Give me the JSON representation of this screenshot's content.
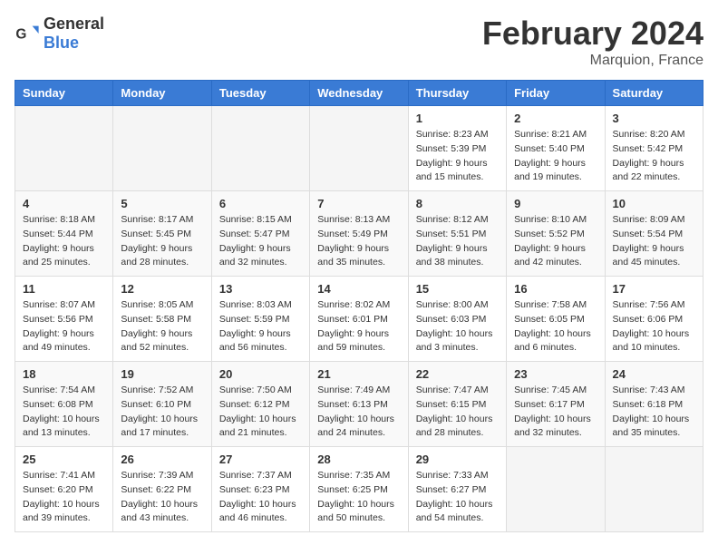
{
  "header": {
    "logo_general": "General",
    "logo_blue": "Blue",
    "main_title": "February 2024",
    "subtitle": "Marquion, France"
  },
  "calendar": {
    "days_of_week": [
      "Sunday",
      "Monday",
      "Tuesday",
      "Wednesday",
      "Thursday",
      "Friday",
      "Saturday"
    ],
    "weeks": [
      {
        "cells": [
          {
            "date": "",
            "info": ""
          },
          {
            "date": "",
            "info": ""
          },
          {
            "date": "",
            "info": ""
          },
          {
            "date": "",
            "info": ""
          },
          {
            "date": "1",
            "info": "Sunrise: 8:23 AM\nSunset: 5:39 PM\nDaylight: 9 hours\nand 15 minutes."
          },
          {
            "date": "2",
            "info": "Sunrise: 8:21 AM\nSunset: 5:40 PM\nDaylight: 9 hours\nand 19 minutes."
          },
          {
            "date": "3",
            "info": "Sunrise: 8:20 AM\nSunset: 5:42 PM\nDaylight: 9 hours\nand 22 minutes."
          }
        ]
      },
      {
        "cells": [
          {
            "date": "4",
            "info": "Sunrise: 8:18 AM\nSunset: 5:44 PM\nDaylight: 9 hours\nand 25 minutes."
          },
          {
            "date": "5",
            "info": "Sunrise: 8:17 AM\nSunset: 5:45 PM\nDaylight: 9 hours\nand 28 minutes."
          },
          {
            "date": "6",
            "info": "Sunrise: 8:15 AM\nSunset: 5:47 PM\nDaylight: 9 hours\nand 32 minutes."
          },
          {
            "date": "7",
            "info": "Sunrise: 8:13 AM\nSunset: 5:49 PM\nDaylight: 9 hours\nand 35 minutes."
          },
          {
            "date": "8",
            "info": "Sunrise: 8:12 AM\nSunset: 5:51 PM\nDaylight: 9 hours\nand 38 minutes."
          },
          {
            "date": "9",
            "info": "Sunrise: 8:10 AM\nSunset: 5:52 PM\nDaylight: 9 hours\nand 42 minutes."
          },
          {
            "date": "10",
            "info": "Sunrise: 8:09 AM\nSunset: 5:54 PM\nDaylight: 9 hours\nand 45 minutes."
          }
        ]
      },
      {
        "cells": [
          {
            "date": "11",
            "info": "Sunrise: 8:07 AM\nSunset: 5:56 PM\nDaylight: 9 hours\nand 49 minutes."
          },
          {
            "date": "12",
            "info": "Sunrise: 8:05 AM\nSunset: 5:58 PM\nDaylight: 9 hours\nand 52 minutes."
          },
          {
            "date": "13",
            "info": "Sunrise: 8:03 AM\nSunset: 5:59 PM\nDaylight: 9 hours\nand 56 minutes."
          },
          {
            "date": "14",
            "info": "Sunrise: 8:02 AM\nSunset: 6:01 PM\nDaylight: 9 hours\nand 59 minutes."
          },
          {
            "date": "15",
            "info": "Sunrise: 8:00 AM\nSunset: 6:03 PM\nDaylight: 10 hours\nand 3 minutes."
          },
          {
            "date": "16",
            "info": "Sunrise: 7:58 AM\nSunset: 6:05 PM\nDaylight: 10 hours\nand 6 minutes."
          },
          {
            "date": "17",
            "info": "Sunrise: 7:56 AM\nSunset: 6:06 PM\nDaylight: 10 hours\nand 10 minutes."
          }
        ]
      },
      {
        "cells": [
          {
            "date": "18",
            "info": "Sunrise: 7:54 AM\nSunset: 6:08 PM\nDaylight: 10 hours\nand 13 minutes."
          },
          {
            "date": "19",
            "info": "Sunrise: 7:52 AM\nSunset: 6:10 PM\nDaylight: 10 hours\nand 17 minutes."
          },
          {
            "date": "20",
            "info": "Sunrise: 7:50 AM\nSunset: 6:12 PM\nDaylight: 10 hours\nand 21 minutes."
          },
          {
            "date": "21",
            "info": "Sunrise: 7:49 AM\nSunset: 6:13 PM\nDaylight: 10 hours\nand 24 minutes."
          },
          {
            "date": "22",
            "info": "Sunrise: 7:47 AM\nSunset: 6:15 PM\nDaylight: 10 hours\nand 28 minutes."
          },
          {
            "date": "23",
            "info": "Sunrise: 7:45 AM\nSunset: 6:17 PM\nDaylight: 10 hours\nand 32 minutes."
          },
          {
            "date": "24",
            "info": "Sunrise: 7:43 AM\nSunset: 6:18 PM\nDaylight: 10 hours\nand 35 minutes."
          }
        ]
      },
      {
        "cells": [
          {
            "date": "25",
            "info": "Sunrise: 7:41 AM\nSunset: 6:20 PM\nDaylight: 10 hours\nand 39 minutes."
          },
          {
            "date": "26",
            "info": "Sunrise: 7:39 AM\nSunset: 6:22 PM\nDaylight: 10 hours\nand 43 minutes."
          },
          {
            "date": "27",
            "info": "Sunrise: 7:37 AM\nSunset: 6:23 PM\nDaylight: 10 hours\nand 46 minutes."
          },
          {
            "date": "28",
            "info": "Sunrise: 7:35 AM\nSunset: 6:25 PM\nDaylight: 10 hours\nand 50 minutes."
          },
          {
            "date": "29",
            "info": "Sunrise: 7:33 AM\nSunset: 6:27 PM\nDaylight: 10 hours\nand 54 minutes."
          },
          {
            "date": "",
            "info": ""
          },
          {
            "date": "",
            "info": ""
          }
        ]
      }
    ]
  }
}
